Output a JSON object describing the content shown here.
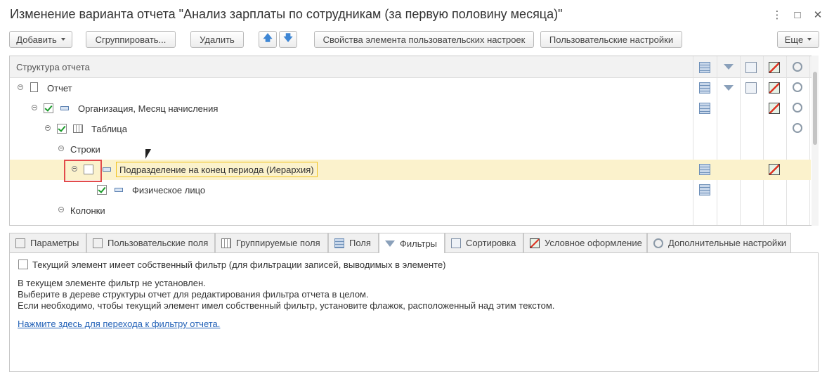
{
  "window": {
    "title": "Изменение варианта отчета \"Анализ зарплаты по сотрудникам (за первую половину месяца)\"",
    "controls": [
      "more-icon",
      "maximize-icon",
      "close-icon"
    ]
  },
  "toolbar": {
    "add_label": "Добавить",
    "group_label": "Сгруппировать...",
    "delete_label": "Удалить",
    "move_up_icon": "arrow-up-icon",
    "move_down_icon": "arrow-down-icon",
    "element_props_label": "Свойства элемента пользовательских настроек",
    "user_settings_label": "Пользовательские настройки",
    "more_label": "Еще"
  },
  "tree": {
    "header": "Структура отчета",
    "column_icons": [
      "fields-icon",
      "filter-icon",
      "sort-icon",
      "conditional-format-icon",
      "other-settings-icon"
    ],
    "rows": [
      {
        "label": "Отчет",
        "checked": null,
        "icon": "report-icon"
      },
      {
        "label": "Организация, Месяц начисления",
        "checked": true,
        "icon": "grouping-icon"
      },
      {
        "label": "Таблица",
        "checked": true,
        "icon": "table-icon"
      },
      {
        "label": "Строки",
        "checked": null,
        "icon": ""
      },
      {
        "label": "Подразделение на конец периода (Иерархия)",
        "checked": false,
        "icon": "grouping-icon",
        "selected": true
      },
      {
        "label": "Физическое лицо",
        "checked": true,
        "icon": "grouping-icon"
      },
      {
        "label": "Колонки",
        "checked": null,
        "icon": ""
      }
    ]
  },
  "tabs": [
    {
      "label": "Параметры",
      "icon": "parameters-icon"
    },
    {
      "label": "Пользовательские поля",
      "icon": "custom-fields-icon"
    },
    {
      "label": "Группируемые поля",
      "icon": "grouped-fields-icon"
    },
    {
      "label": "Поля",
      "icon": "fields-icon"
    },
    {
      "label": "Фильтры",
      "icon": "filter-icon",
      "active": true
    },
    {
      "label": "Сортировка",
      "icon": "sort-icon"
    },
    {
      "label": "Условное оформление",
      "icon": "conditional-format-icon"
    },
    {
      "label": "Дополнительные настройки",
      "icon": "other-settings-icon"
    }
  ],
  "filters_panel": {
    "own_filter_label": "Текущий элемент имеет собственный фильтр (для фильтрации записей, выводимых в элементе)",
    "own_filter_checked": false,
    "info_lines": [
      "В текущем элементе фильтр не установлен.",
      "Выберите в дереве структуры отчет для редактирования фильтра отчета в целом.",
      "Если необходимо, чтобы текущий элемент имел собственный фильтр, установите флажок, расположенный над этим текстом."
    ],
    "link_text": "Нажмите здесь для перехода к фильтру отчета."
  },
  "colors": {
    "selection_bg": "#fbf2cc",
    "selection_border": "#f0c21c",
    "highlight_frame": "#e24b4b",
    "link": "#2563b8",
    "check": "#1a9a2a"
  }
}
